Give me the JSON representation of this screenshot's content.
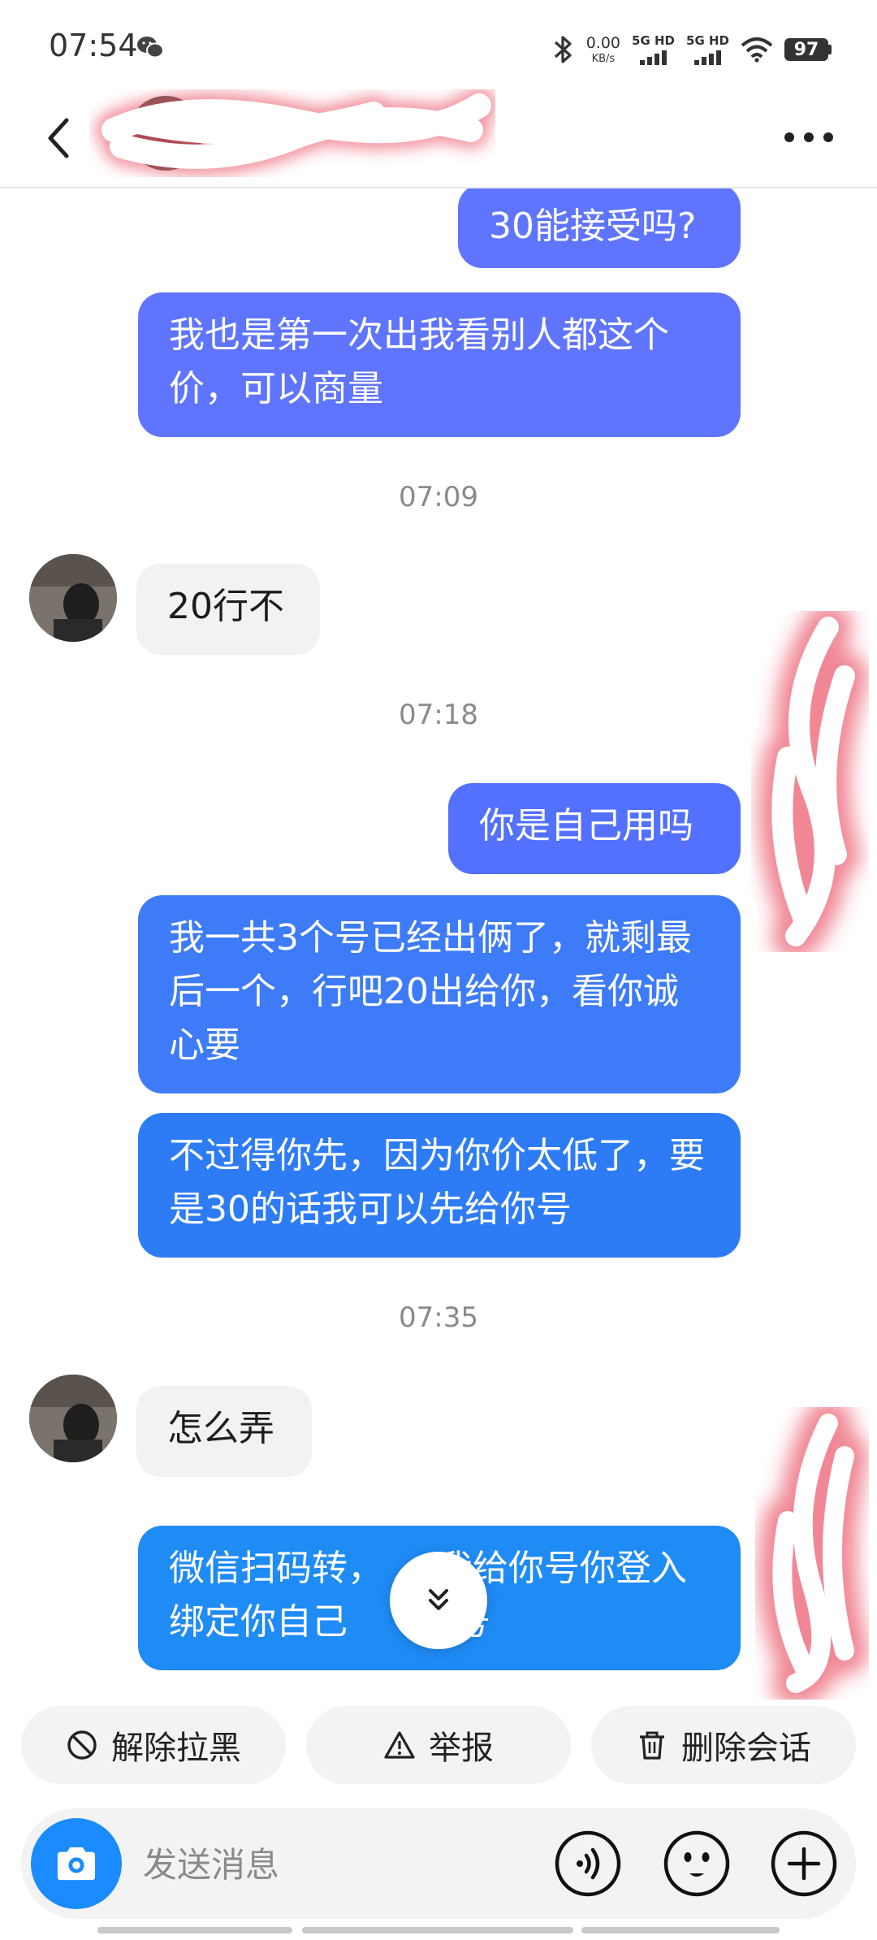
{
  "status_bar": {
    "time": "07:54",
    "net_speed_value": "0.00",
    "net_speed_unit": "KB/s",
    "sim1": "5G HD",
    "sim2": "5G HD",
    "battery": "97"
  },
  "header": {
    "contact_name": ""
  },
  "chat": {
    "messages": [
      {
        "side": "out",
        "text": "30能接受吗?"
      },
      {
        "side": "out",
        "text": "我也是第一次出我看别人都这个价，可以商量"
      },
      {
        "type": "time",
        "text": "07:09"
      },
      {
        "side": "in",
        "text": "20行不"
      },
      {
        "type": "time",
        "text": "07:18"
      },
      {
        "side": "out",
        "text": "你是自己用吗"
      },
      {
        "side": "out",
        "text": "我一共3个号已经出俩了，就剩最后一个，行吧20出给你，看你诚心要"
      },
      {
        "side": "out",
        "text": "不过得你先，因为你价太低了，要是30的话我可以先给你号"
      },
      {
        "type": "time",
        "text": "07:35"
      },
      {
        "side": "in",
        "text": "怎么弄"
      },
      {
        "side": "out",
        "text": "微信扫码转，　　我给你号你登入绑定你自己　　机号"
      }
    ]
  },
  "actions": {
    "unblock": "解除拉黑",
    "report": "举报",
    "delete_chat": "删除会话"
  },
  "composer": {
    "placeholder": "发送消息"
  },
  "colors": {
    "bubble_purple": "#5f75ff",
    "bubble_blue": "#2d7cf6",
    "bubble_bright_blue": "#1f8bf5",
    "camera_blue": "#1a8cff",
    "incoming_bubble": "#f2f2f2"
  },
  "icons": [
    "wechat-icon",
    "bluetooth-icon",
    "wifi-icon",
    "back-icon",
    "more-icon",
    "chevron-double-down-icon",
    "block-icon",
    "warning-icon",
    "trash-icon",
    "camera-icon",
    "voice-icon",
    "emoji-icon",
    "plus-icon"
  ]
}
